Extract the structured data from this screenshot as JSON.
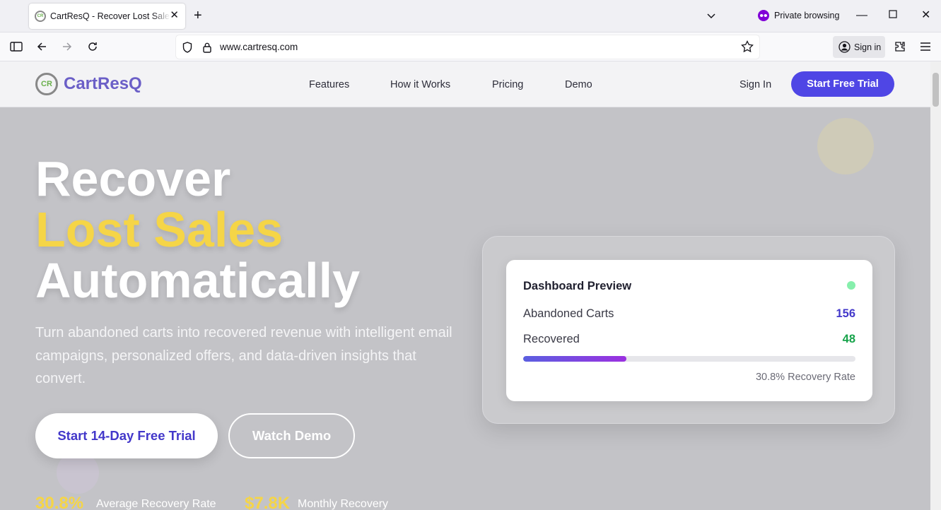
{
  "browser": {
    "tab_title": "CartResQ - Recover Lost Sales with Intelligent Recovery",
    "private_label": "Private browsing",
    "url": "www.cartresq.com",
    "signin_label": "Sign in"
  },
  "site": {
    "logo_text": "CartResQ",
    "logo_mark": "CR",
    "nav": [
      "Features",
      "How it Works",
      "Pricing",
      "Demo"
    ],
    "signin": "Sign In",
    "trial_button": "Start Free Trial"
  },
  "hero": {
    "line1": "Recover",
    "line2": "Lost Sales",
    "line3": "Automatically",
    "subtitle": "Turn abandoned carts into recovered revenue with intelligent email campaigns, personalized offers, and data-driven insights that convert.",
    "cta_primary": "Start 14-Day Free Trial",
    "cta_secondary": "Watch Demo",
    "stats": [
      {
        "value": "30.8%",
        "label": "Average Recovery Rate"
      },
      {
        "value": "$7.8K",
        "label": "Monthly Recovery"
      }
    ]
  },
  "preview": {
    "title": "Dashboard Preview",
    "abandoned_label": "Abandoned Carts",
    "abandoned_value": "156",
    "recovered_label": "Recovered",
    "recovered_value": "48",
    "recovery_fraction": 0.31,
    "rate_text": "30.8% Recovery Rate"
  },
  "colors": {
    "accent": "#4f46e5",
    "highlight": "#f5d547",
    "abandoned_value": "#4338ca",
    "recovered_value": "#16a34a"
  }
}
